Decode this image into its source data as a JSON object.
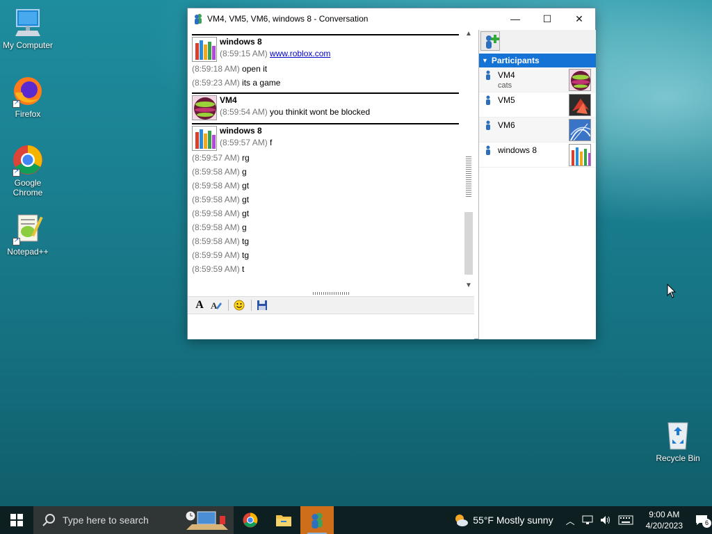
{
  "desktop": {
    "icons": [
      {
        "label": "My Computer",
        "icon": "computer-icon"
      },
      {
        "label": "Firefox",
        "icon": "firefox-icon"
      },
      {
        "label": "Google Chrome",
        "icon": "chrome-icon"
      },
      {
        "label": "Notepad++",
        "icon": "notepadpp-icon"
      },
      {
        "label": "Recycle Bin",
        "icon": "recycle-bin-icon"
      }
    ]
  },
  "window": {
    "title": "VM4, VM5, VM6, windows 8 - Conversation",
    "controls": {
      "minimize": "—",
      "maximize": "☐",
      "close": "✕"
    }
  },
  "conversation": {
    "groups": [
      {
        "sender": "windows 8",
        "first_time": "(8:59:15 AM)",
        "first_text": "www.roblox.com",
        "first_is_link": true,
        "lines": [
          {
            "time": "(8:59:18 AM)",
            "text": "open it"
          },
          {
            "time": "(8:59:23 AM)",
            "text": "its a game"
          }
        ]
      },
      {
        "sender": "VM4",
        "first_time": "(8:59:54 AM)",
        "first_text": "you thinkit wont be blocked",
        "lines": []
      },
      {
        "sender": "windows 8",
        "first_time": "(8:59:57 AM)",
        "first_text": "f",
        "lines": [
          {
            "time": "(8:59:57 AM)",
            "text": "rg"
          },
          {
            "time": "(8:59:58 AM)",
            "text": "g"
          },
          {
            "time": "(8:59:58 AM)",
            "text": "gt"
          },
          {
            "time": "(8:59:58 AM)",
            "text": "gt"
          },
          {
            "time": "(8:59:58 AM)",
            "text": "gt"
          },
          {
            "time": "(8:59:58 AM)",
            "text": "g"
          },
          {
            "time": "(8:59:58 AM)",
            "text": "tg"
          },
          {
            "time": "(8:59:59 AM)",
            "text": "tg"
          },
          {
            "time": "(8:59:59 AM)",
            "text": "t"
          }
        ]
      }
    ]
  },
  "format_toolbar": {
    "font_label": "A",
    "items": [
      "font-icon",
      "color-icon",
      "emoticon-icon",
      "save-icon"
    ]
  },
  "sidebar": {
    "participants_label": "Participants",
    "participants": [
      {
        "name": "VM4",
        "status": "cats"
      },
      {
        "name": "VM5",
        "status": ""
      },
      {
        "name": "VM6",
        "status": ""
      },
      {
        "name": "windows 8",
        "status": ""
      }
    ]
  },
  "taskbar": {
    "search_placeholder": "Type here to search",
    "weather_temp": "55°F",
    "weather_text": "Mostly sunny",
    "time": "9:00 AM",
    "date": "4/20/2023",
    "notification_count": "6"
  }
}
